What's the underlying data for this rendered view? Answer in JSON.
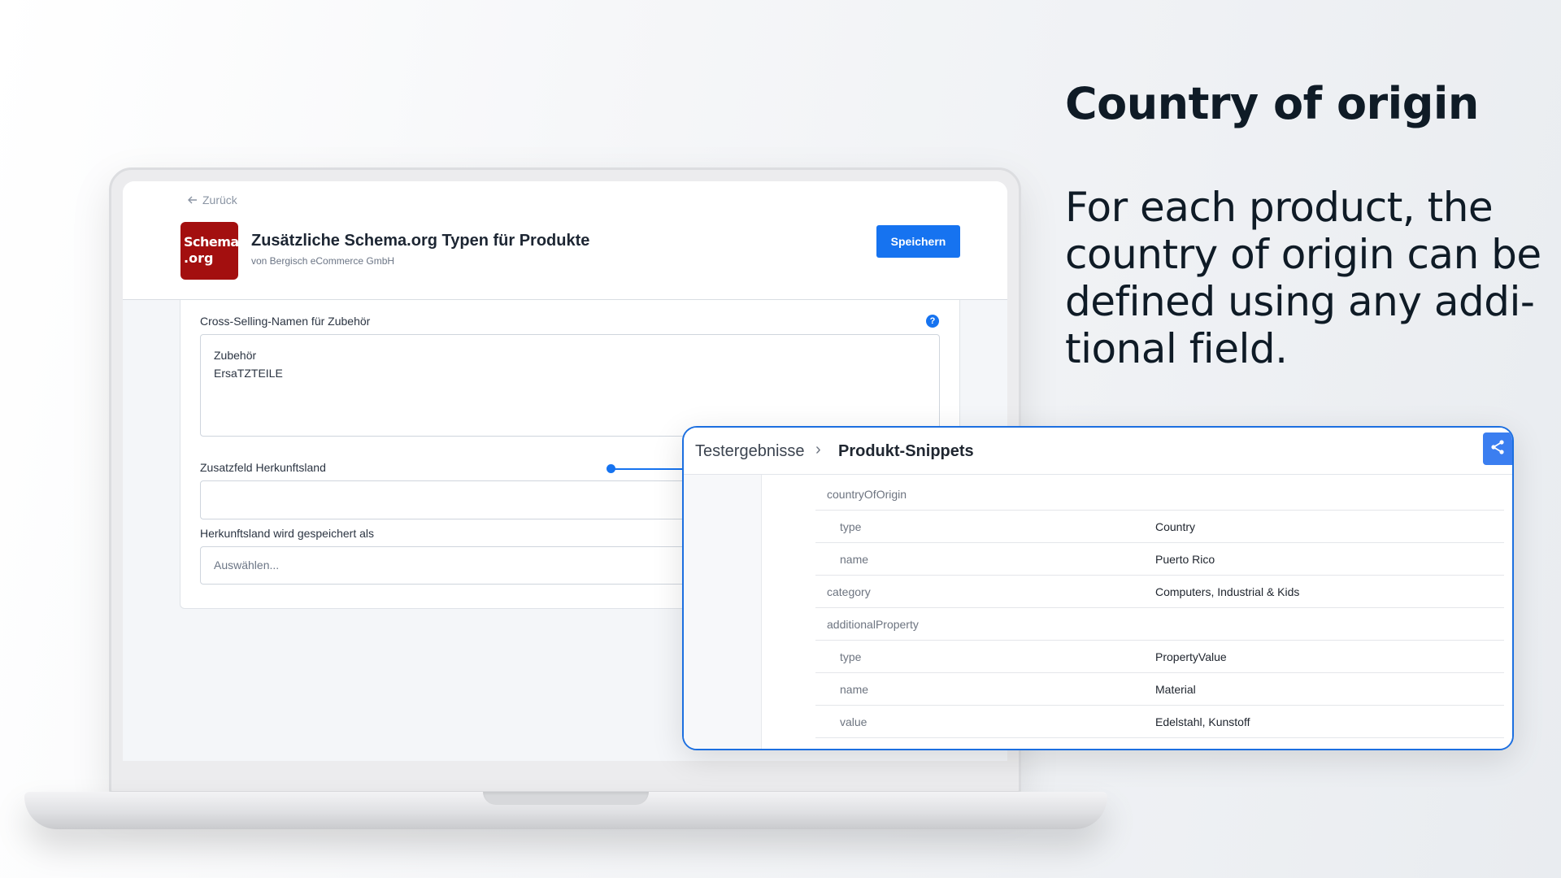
{
  "slide": {
    "headline": "Country of origin",
    "description": "For each product, the country of origin can be defined using any addi-tional field."
  },
  "app": {
    "back_label": "Zurück",
    "logo_line1": "Schema",
    "logo_line2": ".org",
    "title": "Zusätzliche Schema.org Typen für Produkte",
    "vendor": "von Bergisch eCommerce GmbH",
    "save_label": "Speichern",
    "fields": {
      "cross_selling_label": "Cross-Selling-Namen für Zubehör",
      "cross_selling_values": [
        "Zubehör",
        "ErsaTZTEILE"
      ],
      "origin_field_label": "Zusatzfeld Herkunftsland",
      "origin_field_value": "",
      "saved_as_label": "Herkunftsland wird gespeichert als",
      "saved_as_placeholder": "Auswählen..."
    }
  },
  "popup": {
    "breadcrumb": [
      "Testergebnisse",
      "Produkt-Snippets"
    ],
    "breadcrumb_separator": "›",
    "rows": [
      {
        "key": "countryOfOrigin",
        "value": "",
        "sub": false
      },
      {
        "key": "type",
        "value": "Country",
        "sub": true
      },
      {
        "key": "name",
        "value": "Puerto Rico",
        "sub": true
      },
      {
        "key": "category",
        "value": "Computers, Industrial & Kids",
        "sub": false
      },
      {
        "key": "additionalProperty",
        "value": "",
        "sub": false
      },
      {
        "key": "type",
        "value": "PropertyValue",
        "sub": true
      },
      {
        "key": "name",
        "value": "Material",
        "sub": true
      },
      {
        "key": "value",
        "value": "Edelstahl, Kunstoff",
        "sub": true
      }
    ]
  },
  "icons": {
    "back": "arrow-left-icon",
    "help": "question-icon",
    "share": "share-icon"
  },
  "colors": {
    "accent": "#1673f0",
    "logo_bg": "#a30f0f",
    "popup_border": "#1c6fe0"
  }
}
